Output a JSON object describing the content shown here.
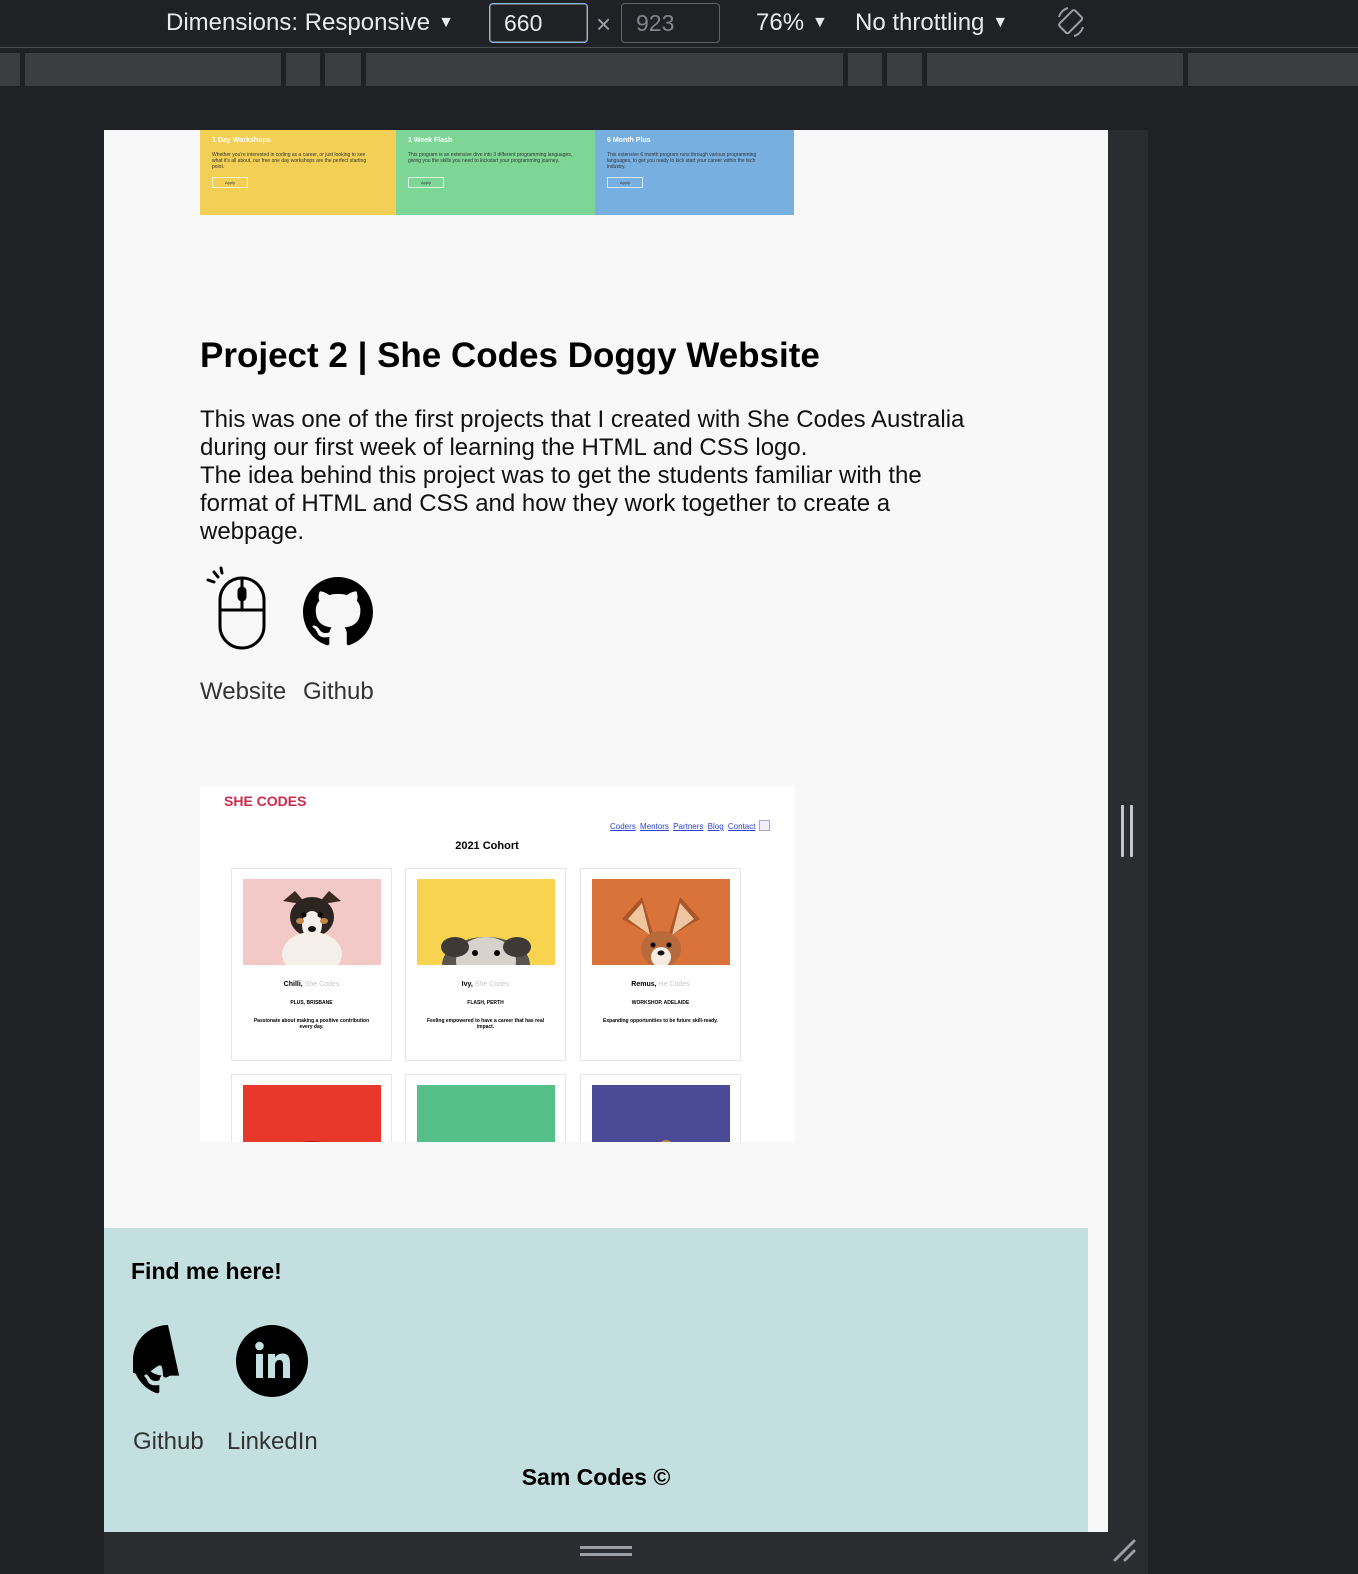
{
  "devtools": {
    "dimensions_label": "Dimensions: Responsive",
    "width_value": "660",
    "height_placeholder": "923",
    "times_symbol": "×",
    "zoom": "76%",
    "throttling": "No throttling",
    "caret": "▼",
    "rotate_icon": "rotate-icon"
  },
  "cards": [
    {
      "title": "1 Day Workshops",
      "text": "Whether you're interested in coding as a career, or just looking to see what it's all about, our free one day workshops are the perfect starting point.",
      "button": "Apply",
      "color": "#f2cf55"
    },
    {
      "title": "1 Week Flash",
      "text": "This program is an extensive dive into 3 different programming languages, giving you the skills you need to kickstart your programming journey.",
      "button": "Apply",
      "color": "#7dd695"
    },
    {
      "title": "6 Month Plus",
      "text": "This extensive 6 month program runs through various programming languages, to get you ready to kick start your career within the tech industry.",
      "button": "Apply",
      "color": "#77afe1"
    }
  ],
  "project": {
    "title": "Project 2 | She Codes Doggy Website",
    "desc_1": "This was one of the first projects that I created with She Codes Australia during our first week of learning the HTML and CSS logo.",
    "desc_2": "The idea behind this project was to get the students familiar with the format of HTML and CSS and how they work together to create a webpage.",
    "website_label": "Website",
    "github_label": "Github",
    "website_icon": "mouse-click-icon",
    "github_icon": "github-icon"
  },
  "preview": {
    "logo": "SHE CODES",
    "nav": [
      "Coders",
      "Mentors",
      "Partners",
      "Blog",
      "Contact"
    ],
    "cohort": "2021 Cohort",
    "cards": [
      {
        "name": "Chilli,",
        "tag": "She Codes",
        "meta": "PLUS, BRISBANE",
        "quote": "Passionate about making a positive contribution every day.",
        "bg": "#f3c9c7"
      },
      {
        "name": "Ivy,",
        "tag": "She Codes",
        "meta": "FLASH, PERTH",
        "quote": "Feeling empowered to have a career that has real impact.",
        "bg": "#f7d34f"
      },
      {
        "name": "Remus,",
        "tag": "He Codes",
        "meta": "WORKSHOP, ADELAIDE",
        "quote": "Expanding opportunities to be future skill-ready.",
        "bg": "#d9733a"
      }
    ],
    "row2_colors": [
      "#e8382b",
      "#55c08a",
      "#4b4a97"
    ]
  },
  "footer": {
    "title": "Find me here!",
    "github_label": "Github",
    "linkedin_label": "LinkedIn",
    "copyright": "Sam Codes ©",
    "bg": "#c4dfdf"
  }
}
